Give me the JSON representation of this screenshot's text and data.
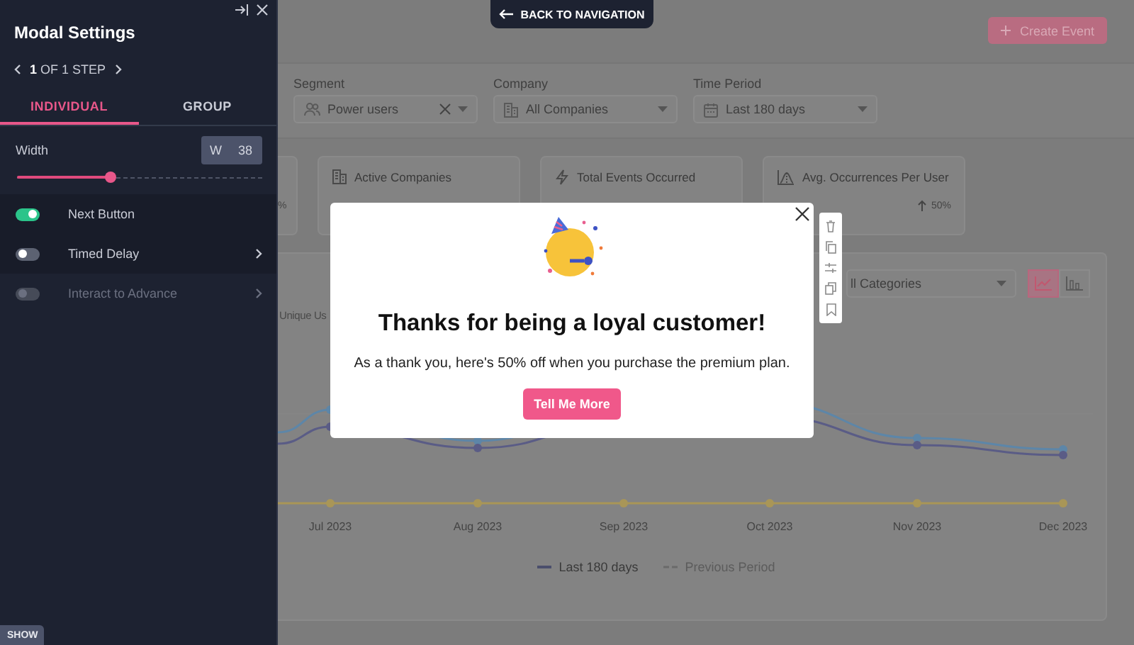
{
  "panel": {
    "title": "Modal Settings",
    "step_label": "**1** OF 1 STEP",
    "tabs": [
      {
        "label": "INDIVIDUAL",
        "selected": true
      },
      {
        "label": "GROUP",
        "selected": false
      }
    ],
    "width": {
      "label": "Width",
      "prefix": "W",
      "value": "38",
      "level": 0.38
    },
    "options": [
      {
        "label": "Next Button",
        "on": true,
        "disabled": false,
        "has_submenu": false
      },
      {
        "label": "Timed Delay",
        "on": false,
        "disabled": false,
        "has_submenu": true
      },
      {
        "label": "Interact to Advance",
        "on": false,
        "disabled": true,
        "has_submenu": true
      }
    ],
    "show_button": "SHOW"
  },
  "back_button": "BACK TO NAVIGATION",
  "create_button": "Create Event",
  "filters": [
    {
      "label": "Segment",
      "value": "Power users",
      "kind": "users",
      "clearable": true
    },
    {
      "label": "Company",
      "value": "All Companies",
      "kind": "building",
      "clearable": false
    },
    {
      "label": "Time Period",
      "value": "Last 180 days",
      "kind": "calendar",
      "clearable": false
    }
  ],
  "stats": [
    {
      "kind": "partial",
      "value": "%"
    },
    {
      "kind": "building",
      "title": "Active Companies"
    },
    {
      "kind": "bolt",
      "title": "Total Events Occurred"
    },
    {
      "kind": "curve",
      "title": "Avg. Occurrences Per User",
      "change": "50%"
    }
  ],
  "chart": {
    "series_label": "Unique Us",
    "category_select": "ll Categories",
    "view_modes": [
      {
        "kind": "line",
        "selected": true
      },
      {
        "kind": "bar",
        "selected": false
      }
    ],
    "x_labels": [
      "Jul 2023",
      "Aug 2023",
      "Sep 2023",
      "Oct 2023",
      "Nov 2023",
      "Dec 2023"
    ],
    "legend": [
      {
        "label": "Last 180 days",
        "kind": "solid",
        "selected": true
      },
      {
        "label": "Previous Period",
        "kind": "dashed",
        "selected": false
      }
    ]
  },
  "modal": {
    "title": "Thanks for being a loyal customer!",
    "body": "As a thank you, here's 50% off when you purchase the premium plan.",
    "button": "Tell Me More"
  },
  "toolbar": [
    {
      "kind": "delete"
    },
    {
      "kind": "copy"
    },
    {
      "kind": "adjust"
    },
    {
      "kind": "duplicate"
    },
    {
      "kind": "bookmark"
    }
  ]
}
